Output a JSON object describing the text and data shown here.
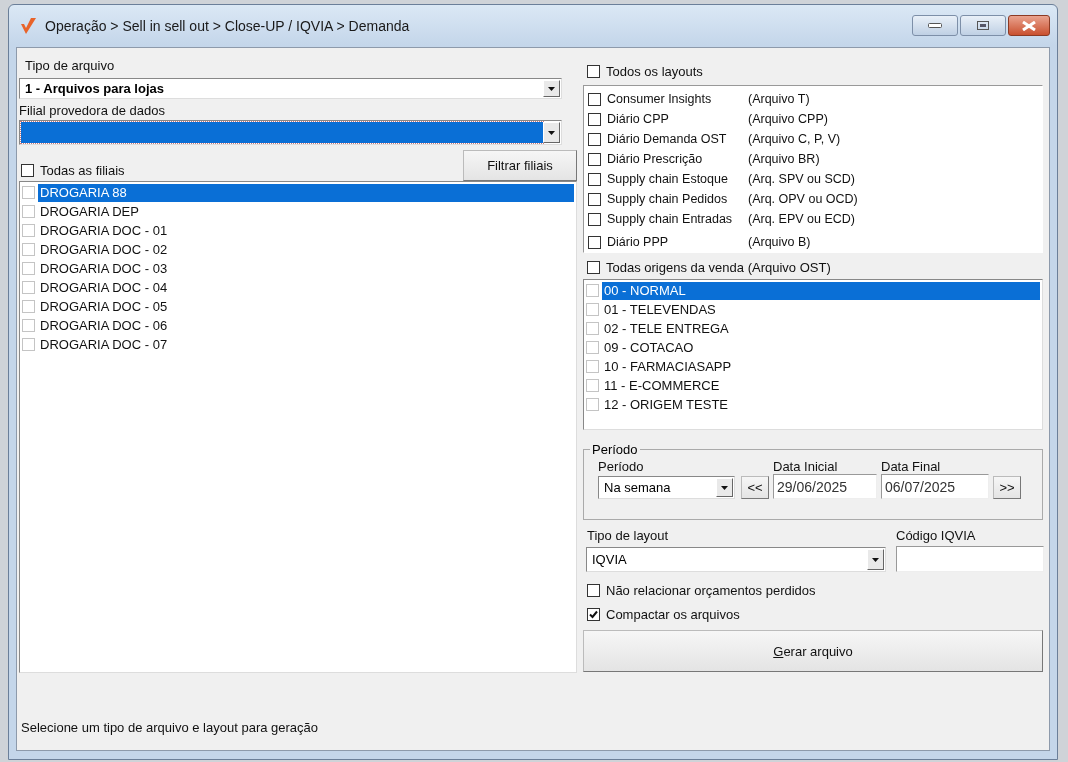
{
  "window": {
    "title": "Operação > Sell in sell out > Close-UP / IQVIA > Demanda"
  },
  "tipo_arquivo": {
    "label": "Tipo de arquivo",
    "value": "1 - Arquivos para lojas"
  },
  "filial_provedora": {
    "label": "Filial provedora de dados",
    "selected": true
  },
  "filiais": {
    "all_label": "Todas as filiais",
    "all_checked": false,
    "filter_button": "Filtrar filiais",
    "items": [
      {
        "label": "DROGARIA 88",
        "checked": false,
        "selected": true
      },
      {
        "label": "DROGARIA DEP",
        "checked": false,
        "selected": false
      },
      {
        "label": "DROGARIA DOC - 01",
        "checked": false,
        "selected": false
      },
      {
        "label": "DROGARIA DOC - 02",
        "checked": false,
        "selected": false
      },
      {
        "label": "DROGARIA DOC - 03",
        "checked": false,
        "selected": false
      },
      {
        "label": "DROGARIA DOC - 04",
        "checked": false,
        "selected": false
      },
      {
        "label": "DROGARIA DOC - 05",
        "checked": false,
        "selected": false
      },
      {
        "label": "DROGARIA DOC - 06",
        "checked": false,
        "selected": false
      },
      {
        "label": "DROGARIA DOC - 07",
        "checked": false,
        "selected": false
      }
    ]
  },
  "layouts": {
    "all_label": "Todos os layouts",
    "all_checked": false,
    "items": [
      {
        "name": "Consumer Insights",
        "file": "(Arquivo T)",
        "checked": false
      },
      {
        "name": "Diário CPP",
        "file": "(Arquivo CPP)",
        "checked": false
      },
      {
        "name": "Diário Demanda OST",
        "file": "(Arquivo C, P, V)",
        "checked": false
      },
      {
        "name": "Diário Prescrição",
        "file": "(Arquivo BR)",
        "checked": false
      },
      {
        "name": "Supply chain Estoque",
        "file": "(Arq. SPV ou SCD)",
        "checked": false
      },
      {
        "name": "Supply chain Pedidos",
        "file": "(Arq. OPV ou OCD)",
        "checked": false
      },
      {
        "name": "Supply chain Entradas",
        "file": "(Arq. EPV ou ECD)",
        "checked": false
      },
      {
        "name": "Diário PPP",
        "file": "(Arquivo B)",
        "checked": false
      }
    ]
  },
  "origens": {
    "all_label": "Todas origens da venda (Arquivo OST)",
    "all_checked": false,
    "items": [
      {
        "label": "00 - NORMAL",
        "checked": false,
        "selected": true
      },
      {
        "label": "01 - TELEVENDAS",
        "checked": false,
        "selected": false
      },
      {
        "label": "02 - TELE ENTREGA",
        "checked": false,
        "selected": false
      },
      {
        "label": "09 - COTACAO",
        "checked": false,
        "selected": false
      },
      {
        "label": "10 - FARMACIASAPP",
        "checked": false,
        "selected": false
      },
      {
        "label": "11 - E-COMMERCE",
        "checked": false,
        "selected": false
      },
      {
        "label": "12 - ORIGEM TESTE",
        "checked": false,
        "selected": false
      }
    ]
  },
  "periodo": {
    "group_title": "Período",
    "period_label": "Período",
    "period_value": "Na semana",
    "prev_button": "<<",
    "start_label": "Data Inicial",
    "start_value": "29/06/2025",
    "end_label": "Data Final",
    "end_value": "06/07/2025",
    "next_button": ">>"
  },
  "tipo_layout": {
    "label": "Tipo de layout",
    "value": "IQVIA"
  },
  "codigo_iqvia": {
    "label": "Código IQVIA"
  },
  "options": [
    {
      "label": "Não relacionar orçamentos perdidos",
      "checked": false
    },
    {
      "label": "Compactar os arquivos",
      "checked": true
    }
  ],
  "generate_button": "Gerar arquivo",
  "status_bar": "Selecione um tipo de arquivo e layout para geração"
}
